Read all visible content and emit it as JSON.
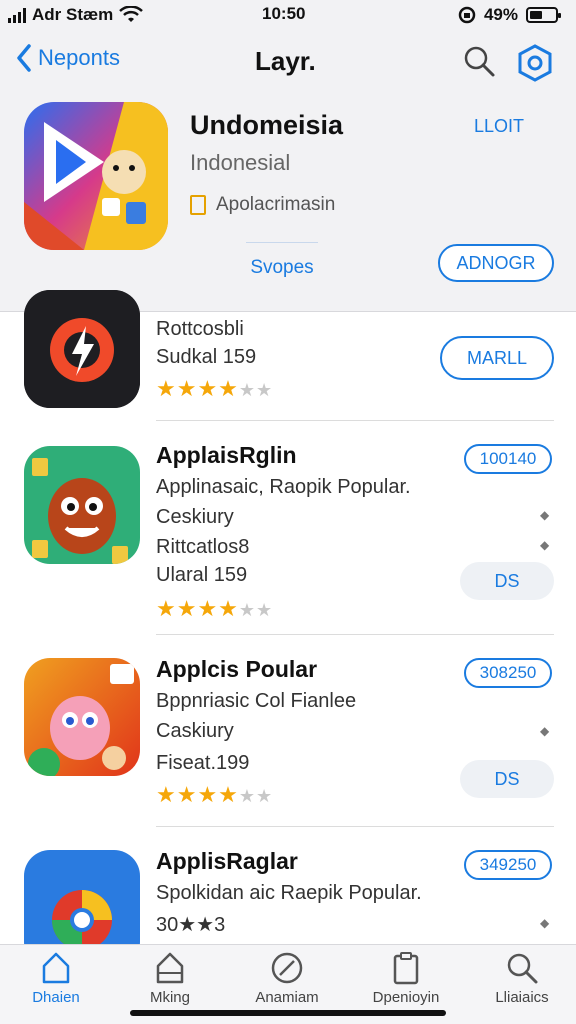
{
  "status": {
    "carrier": "Adr Stæm",
    "time": "10:50",
    "battery": "49%",
    "battery_level": 0.49
  },
  "nav": {
    "back_label": "Neponts",
    "title": "Layr."
  },
  "featured": {
    "title": "Undomeisia",
    "subtitle": "Indonesial",
    "category": "Apolacrimasin",
    "link": "LLOIT",
    "tab": "Svopes",
    "button": "ADNOGR"
  },
  "apps": [
    {
      "name": "",
      "line1": "Rottcosbli",
      "line2": "Sudkal 159",
      "stars": "4",
      "button": "MARLL"
    },
    {
      "name": "ApplaisRglin",
      "line1": "Applinasaic, Raopik Popular.",
      "line2": "Ceskiury",
      "line3": "Rittcatlos8",
      "line4": "Ularal 159",
      "stars": "4",
      "price": "100140",
      "button": "DS"
    },
    {
      "name": "Applcis Poular",
      "line1": "Bppnriasic Col Fianlee",
      "line2": "Caskiury",
      "line3": "Fiseat.199",
      "stars": "4",
      "price": "308250",
      "button": "DS"
    },
    {
      "name": "ApplisRaglar",
      "line1": "Spolkidan aic Raepik Popular.",
      "line2": "30★★3",
      "price": "349250"
    }
  ],
  "tabs": [
    "Dhaien",
    "Mking",
    "Anamiam",
    "Dpenioyin",
    "Lliaiaics"
  ],
  "colors": {
    "accent": "#1a7be0",
    "star": "#f5a70a"
  }
}
